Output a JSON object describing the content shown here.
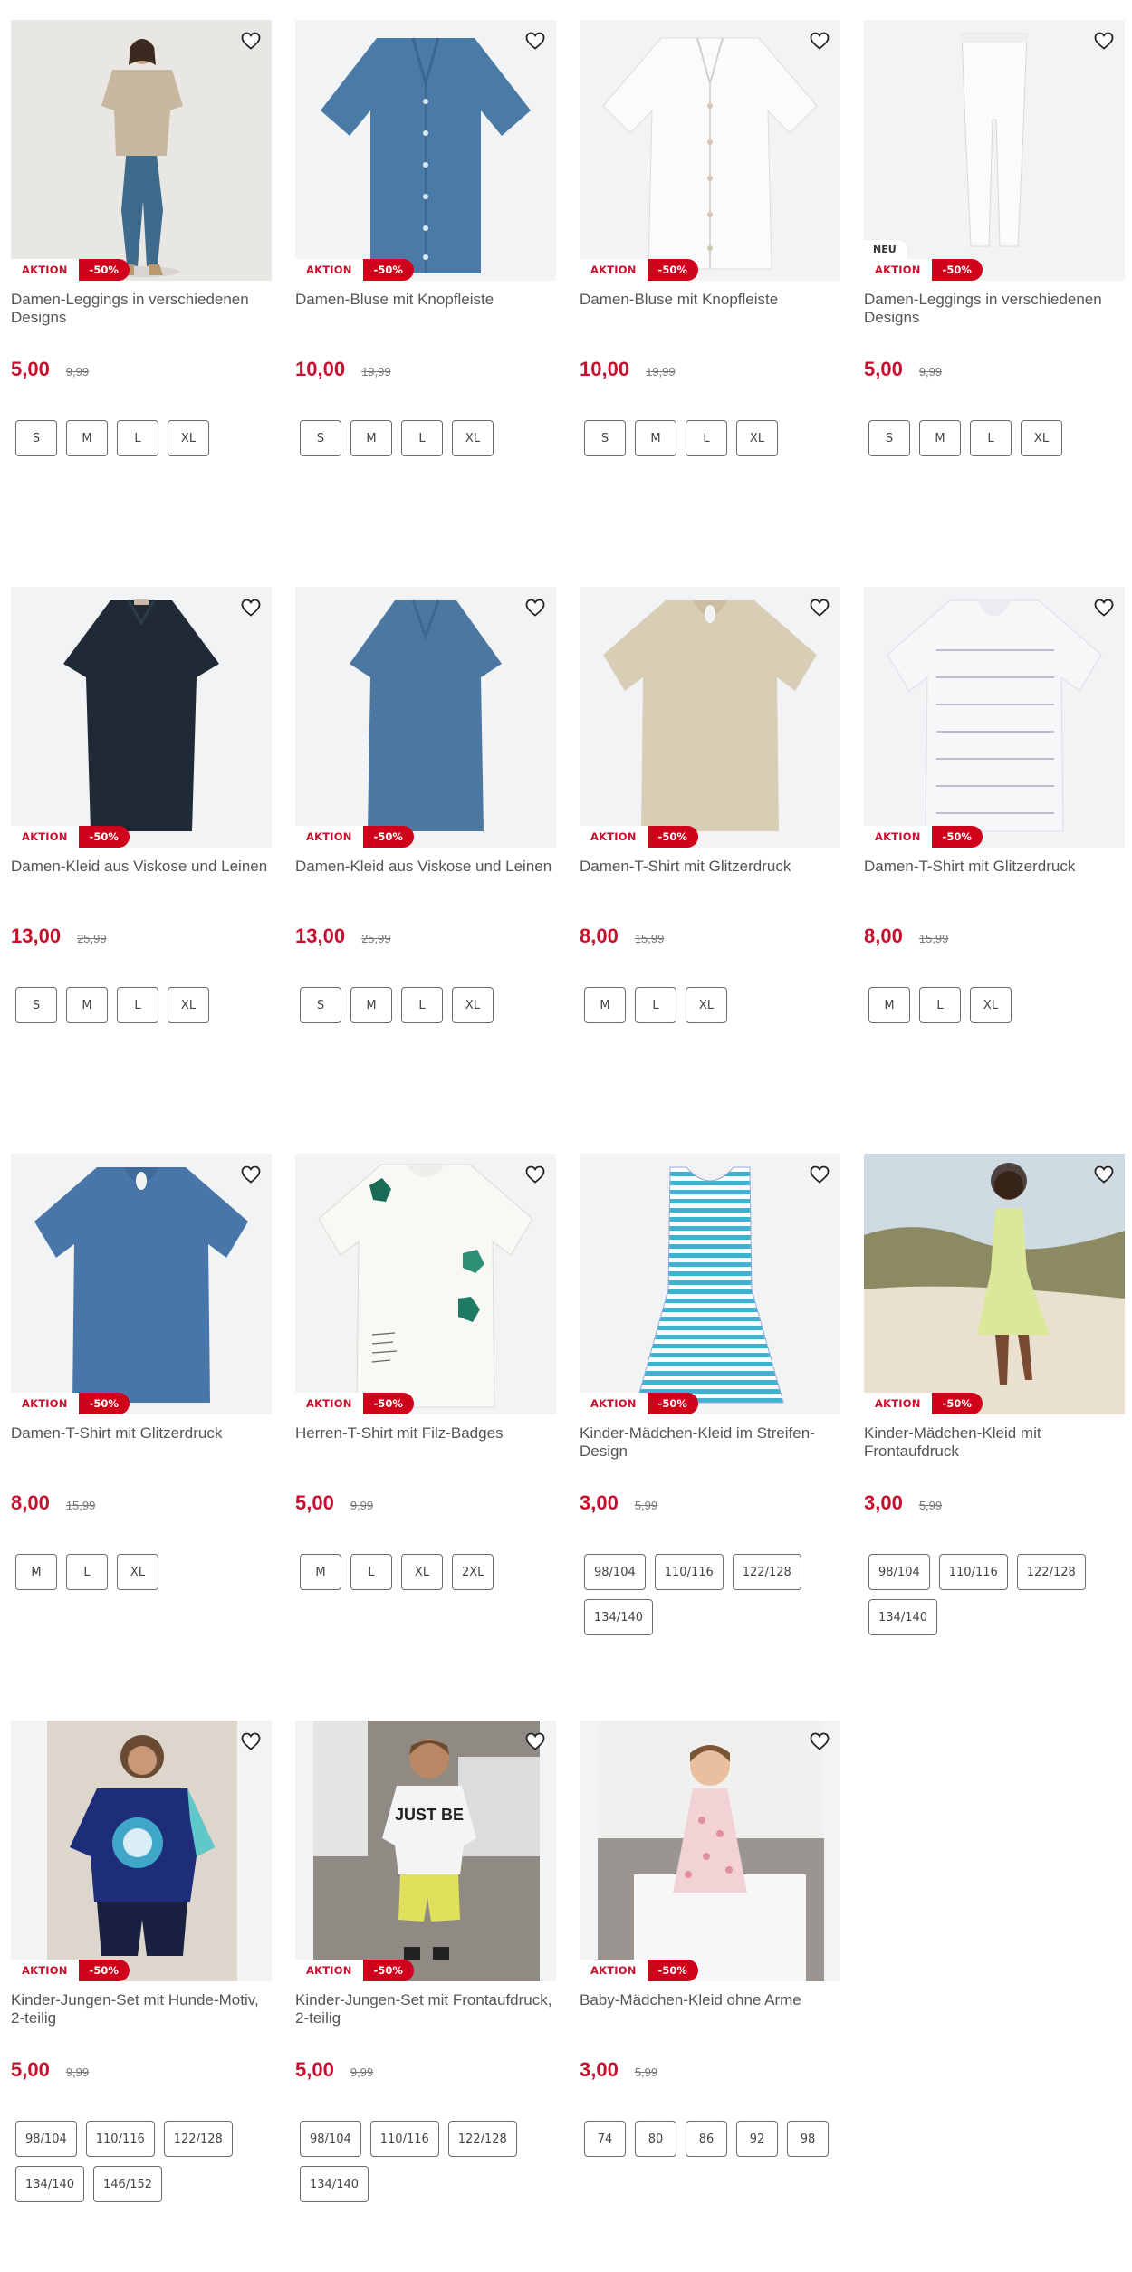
{
  "labels": {
    "aktion": "AKTION",
    "neu": "NEU"
  },
  "colors": {
    "accent": "#c8102e",
    "badge_red": "#d0021b",
    "image_bg": "#f2f3f4"
  },
  "icons": {
    "wishlist": "heart-outline-icon"
  },
  "products": [
    {
      "title": "Damen-Leggings in verschiedenen Designs",
      "price": "5,00",
      "old_price": "9,99",
      "discount": "-50%",
      "neu": false,
      "sizes": [
        "S",
        "M",
        "L",
        "XL"
      ],
      "image": "woman-leggings-model"
    },
    {
      "title": "Damen-Bluse mit Knopfleiste",
      "price": "10,00",
      "old_price": "19,99",
      "discount": "-50%",
      "neu": false,
      "sizes": [
        "S",
        "M",
        "L",
        "XL"
      ],
      "image": "blue-blouse"
    },
    {
      "title": "Damen-Bluse mit Knopfleiste",
      "price": "10,00",
      "old_price": "19,99",
      "discount": "-50%",
      "neu": false,
      "sizes": [
        "S",
        "M",
        "L",
        "XL"
      ],
      "image": "white-blouse"
    },
    {
      "title": "Damen-Leggings in verschiedenen Designs",
      "price": "5,00",
      "old_price": "9,99",
      "discount": "-50%",
      "neu": true,
      "sizes": [
        "S",
        "M",
        "L",
        "XL"
      ],
      "image": "white-leggings"
    },
    {
      "title": "Damen-Kleid aus Viskose und Leinen",
      "price": "13,00",
      "old_price": "25,99",
      "discount": "-50%",
      "neu": false,
      "sizes": [
        "S",
        "M",
        "L",
        "XL"
      ],
      "image": "navy-dress"
    },
    {
      "title": "Damen-Kleid aus Viskose und Leinen",
      "price": "13,00",
      "old_price": "25,99",
      "discount": "-50%",
      "neu": false,
      "sizes": [
        "S",
        "M",
        "L",
        "XL"
      ],
      "image": "blue-dress"
    },
    {
      "title": "Damen-T-Shirt mit Glitzerdruck",
      "price": "8,00",
      "old_price": "15,99",
      "discount": "-50%",
      "neu": false,
      "sizes": [
        "M",
        "L",
        "XL"
      ],
      "image": "beige-tshirt"
    },
    {
      "title": "Damen-T-Shirt mit Glitzerdruck",
      "price": "8,00",
      "old_price": "15,99",
      "discount": "-50%",
      "neu": false,
      "sizes": [
        "M",
        "L",
        "XL"
      ],
      "image": "white-print-tshirt"
    },
    {
      "title": "Damen-T-Shirt mit Glitzerdruck",
      "price": "8,00",
      "old_price": "15,99",
      "discount": "-50%",
      "neu": false,
      "sizes": [
        "M",
        "L",
        "XL"
      ],
      "image": "blue-tshirt"
    },
    {
      "title": "Herren-T-Shirt mit Filz-Badges",
      "price": "5,00",
      "old_price": "9,99",
      "discount": "-50%",
      "neu": false,
      "sizes": [
        "M",
        "L",
        "XL",
        "2XL"
      ],
      "image": "white-badge-tshirt"
    },
    {
      "title": "Kinder-Mädchen-Kleid im Streifen-Design",
      "price": "3,00",
      "old_price": "5,99",
      "discount": "-50%",
      "neu": false,
      "sizes": [
        "98/104",
        "110/116",
        "122/128",
        "134/140"
      ],
      "image": "striped-girl-dress"
    },
    {
      "title": "Kinder-Mädchen-Kleid mit Frontaufdruck",
      "price": "3,00",
      "old_price": "5,99",
      "discount": "-50%",
      "neu": false,
      "sizes": [
        "98/104",
        "110/116",
        "122/128",
        "134/140"
      ],
      "image": "girl-beach-dress"
    },
    {
      "title": "Kinder-Jungen-Set mit Hunde-Motiv, 2-teilig",
      "price": "5,00",
      "old_price": "9,99",
      "discount": "-50%",
      "neu": false,
      "sizes": [
        "98/104",
        "110/116",
        "122/128",
        "134/140",
        "146/152"
      ],
      "image": "boy-dog-set"
    },
    {
      "title": "Kinder-Jungen-Set mit Frontaufdruck, 2-teilig",
      "price": "5,00",
      "old_price": "9,99",
      "discount": "-50%",
      "neu": false,
      "sizes": [
        "98/104",
        "110/116",
        "122/128",
        "134/140"
      ],
      "image": "boy-print-set"
    },
    {
      "title": "Baby-Mädchen-Kleid ohne Arme",
      "price": "3,00",
      "old_price": "5,99",
      "discount": "-50%",
      "neu": false,
      "sizes": [
        "74",
        "80",
        "86",
        "92",
        "98"
      ],
      "image": "baby-floral-dress"
    }
  ]
}
